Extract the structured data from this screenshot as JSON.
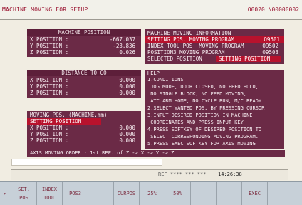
{
  "title_left": "MACHINE MOVING FOR SETUP",
  "title_right": "O0020 N00000002",
  "machine_position": {
    "header": "MACHINE POSITION",
    "rows": [
      {
        "label": "X POSITION :",
        "value": "-667.037"
      },
      {
        "label": "Y POSITION :",
        "value": "-23.836"
      },
      {
        "label": "Z POSITION :",
        "value": "0.026"
      }
    ]
  },
  "distance_to_go": {
    "header": "DISTANCE TO GO",
    "rows": [
      {
        "label": "X POSITION :",
        "value": "0.000"
      },
      {
        "label": "Y POSITION :",
        "value": "0.000"
      },
      {
        "label": "Z POSITION :",
        "value": "0.000"
      }
    ]
  },
  "moving_pos": {
    "header": "MOVING POS. (MACHINE.mm)",
    "setting_label": "SETTING POSITION",
    "rows": [
      {
        "label": "X POSITION :",
        "value": "0.000"
      },
      {
        "label": "Y POSITION :",
        "value": "0.000"
      },
      {
        "label": "Z POSITION :",
        "value": "0.000"
      }
    ],
    "order_text": "AXIS MOVING ORDER : 1st.REF. of Z -> X -> Y -> Z"
  },
  "info": {
    "header": "MACHINE MOVING INFORMATION",
    "rows": [
      {
        "label": "SETTING POS. MOVING PROGRAM",
        "value": "O9501"
      },
      {
        "label": "INDEX TOOL POS. MOVING PROGRAM",
        "value": "O9502"
      },
      {
        "label": "POSITION3 MOVING PROGRAM",
        "value": "O9503"
      }
    ],
    "selected_label": "SELECTED POSITION",
    "selected_value": "SETTING POSITION"
  },
  "help": {
    "header": "HELP",
    "lines": [
      "1.CONDITIONS",
      " JOG MODE, DOOR CLOSED, NO FEED HOLD,",
      " NO SINGLE BLOCK, NO FEED MOVING,",
      " ATC ARM HOME, NO CYCLE RUN, M/C READY",
      "2.SELECT WANTED POS. BY PRESSING CURSOR",
      "3.INPUT DESIRED POSITION IN MACHINE",
      " COORDINATES AND PRESS INPUT KEY",
      "4.PRESS SOFTKEY OF DESIRED POSITION TO",
      " SELECT CORRESPONDING MOVING PROGRAM.",
      "5.PRESS EXEC SOFTKEY FOR AXIS MOVING"
    ]
  },
  "status": {
    "ref": "REF **** *** ***",
    "clock": "14:26:38"
  },
  "softkeys": [
    {
      "line1": "▸",
      "line2": ""
    },
    {
      "line1": "SET.",
      "line2": "POS"
    },
    {
      "line1": "INDEX",
      "line2": "TOOL"
    },
    {
      "line1": "POS3",
      "line2": ""
    },
    {
      "line1": "",
      "line2": ""
    },
    {
      "line1": "CURPOS",
      "line2": ""
    },
    {
      "line1": "25%",
      "line2": ""
    },
    {
      "line1": "50%",
      "line2": ""
    },
    {
      "line1": "",
      "line2": ""
    },
    {
      "line1": "",
      "line2": ""
    },
    {
      "line1": "EXEC",
      "line2": ""
    },
    {
      "line1": "",
      "line2": ""
    }
  ]
}
